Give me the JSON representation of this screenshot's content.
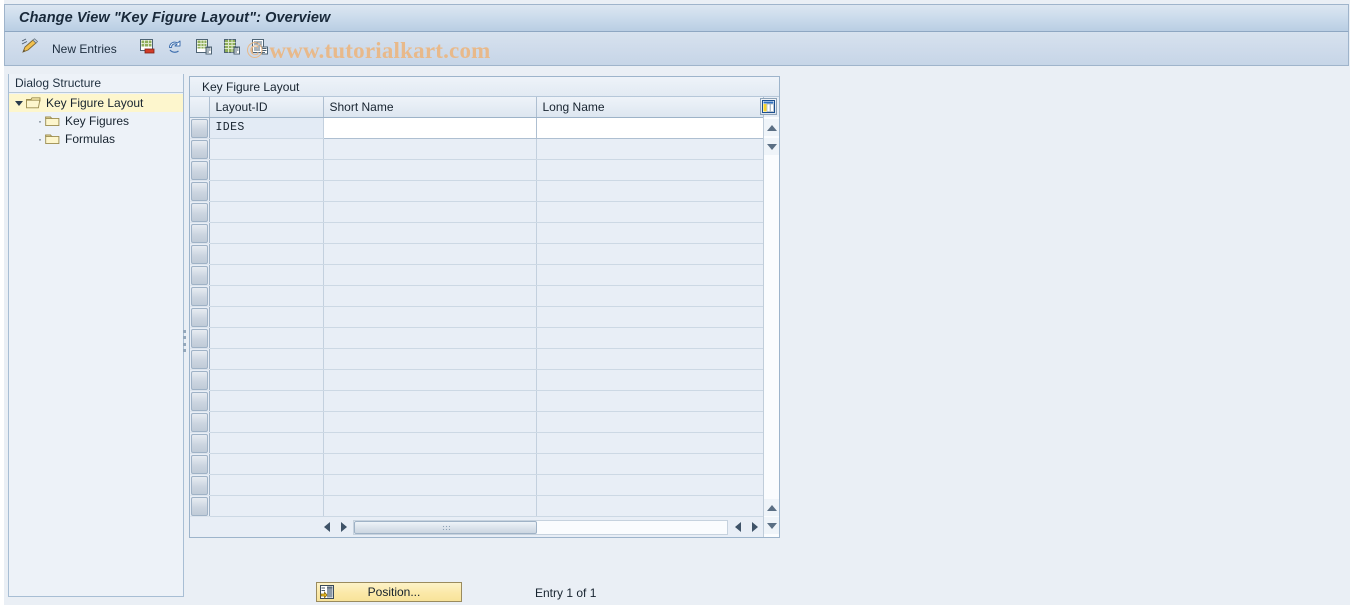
{
  "window": {
    "title": "Change View \"Key Figure Layout\": Overview"
  },
  "toolbar": {
    "display_change_icon": "display-change-pencil-icon",
    "new_entries_label": "New Entries",
    "buttons": [
      {
        "name": "copy-as-icon",
        "label": ""
      },
      {
        "name": "undo-icon",
        "label": ""
      },
      {
        "name": "delete-entry-icon",
        "label": ""
      },
      {
        "name": "select-all-icon",
        "label": ""
      },
      {
        "name": "details-icon",
        "label": ""
      }
    ],
    "watermark": "© www.tutorialkart.com"
  },
  "sidebar": {
    "header": "Dialog Structure",
    "items": [
      {
        "label": "Key Figure Layout",
        "level": 0,
        "selected": true
      },
      {
        "label": "Key Figures",
        "level": 1,
        "selected": false
      },
      {
        "label": "Formulas",
        "level": 1,
        "selected": false
      }
    ]
  },
  "table": {
    "panel_title": "Key Figure Layout",
    "config_icon": "table-settings-icon",
    "columns": [
      "Layout-ID",
      "Short Name",
      "Long Name"
    ],
    "rows": [
      {
        "layout_id": "IDES",
        "short_name": "",
        "long_name": ""
      }
    ],
    "empty_row_count": 18
  },
  "footer": {
    "position_button_label": "Position...",
    "position_icon": "position-arrow-icon",
    "entry_status": "Entry 1 of 1"
  },
  "colors": {
    "accent_title": "#b9cee3",
    "selected_tree_row": "#fdf6cd",
    "button_yellow": "#fbe9a8",
    "watermark": "#e8b98a"
  }
}
